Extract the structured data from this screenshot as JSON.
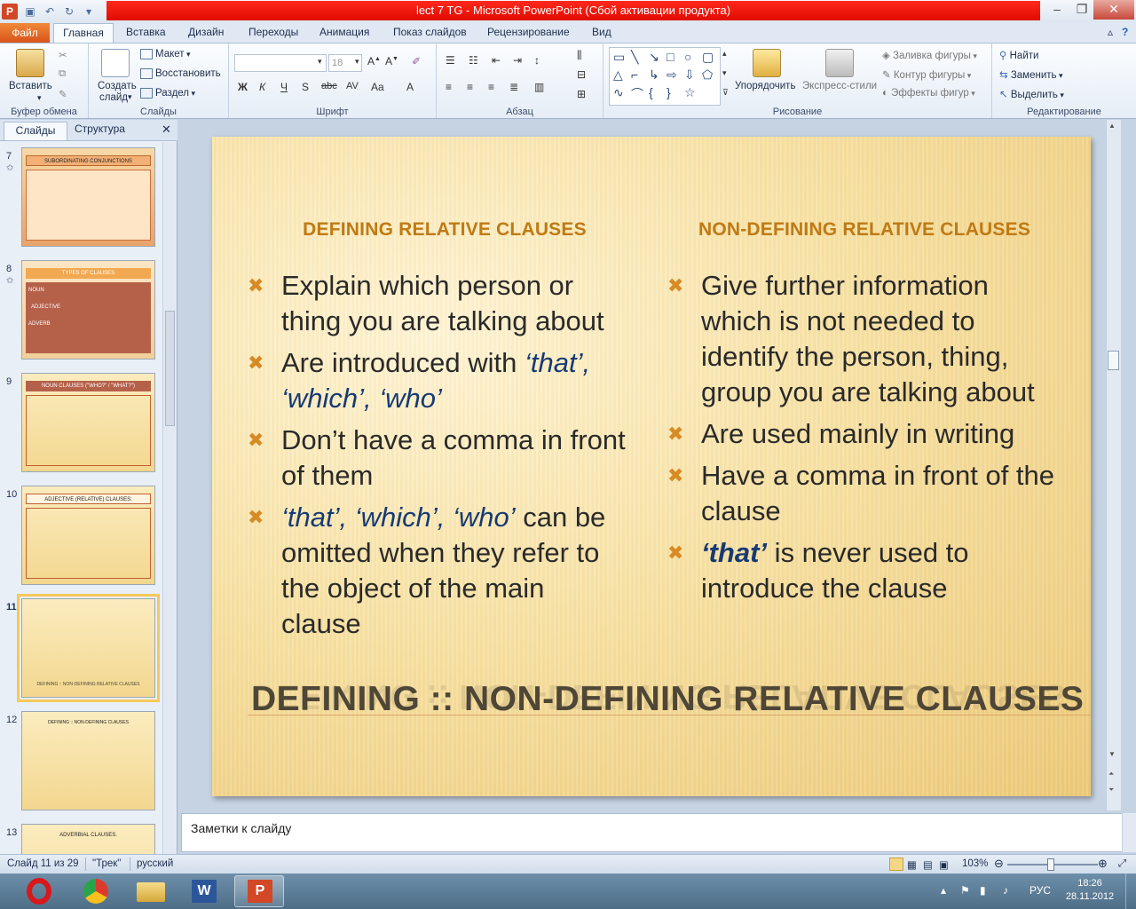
{
  "window": {
    "title": "lect 7 TG - Microsoft PowerPoint (Сбой активации продукта)"
  },
  "ribbon": {
    "tabs": [
      "Главная",
      "Вставка",
      "Дизайн",
      "Переходы",
      "Анимация",
      "Показ слайдов",
      "Рецензирование",
      "Вид"
    ],
    "file_tab": "Файл",
    "groups": {
      "clipboard": {
        "label": "Буфер обмена",
        "paste": "Вставить"
      },
      "slides": {
        "label": "Слайды",
        "new_slide_line1": "Создать",
        "new_slide_line2": "слайд",
        "layout": "Макет",
        "reset": "Восстановить",
        "section": "Раздел"
      },
      "font": {
        "label": "Шрифт",
        "size": "18"
      },
      "paragraph": {
        "label": "Абзац"
      },
      "drawing": {
        "label": "Рисование",
        "arrange": "Упорядочить",
        "quick_styles": "Экспресс-стили",
        "fill": "Заливка фигуры",
        "outline": "Контур фигуры",
        "effects": "Эффекты фигур"
      },
      "editing": {
        "label": "Редактирование",
        "find": "Найти",
        "replace": "Заменить",
        "select": "Выделить"
      }
    }
  },
  "left_pane": {
    "tabs": [
      "Слайды",
      "Структура"
    ],
    "thumbnails": [
      {
        "num": "7",
        "title": "SUBORDINATING CONJUNCTIONS"
      },
      {
        "num": "8",
        "title": "TYPES OF CLAUSES",
        "items": [
          "NOUN",
          "ADJECTIVE",
          "ADVERB"
        ]
      },
      {
        "num": "9",
        "title": "NOUN CLAUSES (\"WHO?\" / \"WHAT?\")"
      },
      {
        "num": "10",
        "title": "ADJECTIVE (RELATIVE) CLAUSES:"
      },
      {
        "num": "11",
        "title": "DEFINING :: NON-DEFINING RELATIVE CLAUSES"
      },
      {
        "num": "12",
        "title": "DEFINING :: NON-DEFINING CLAUSES"
      },
      {
        "num": "13",
        "title": "ADVERBIAL CLAUSES."
      }
    ]
  },
  "slide": {
    "left": {
      "title": "DEFINING RELATIVE CLAUSES",
      "b1": "Explain which person or thing you are talking about",
      "b2_pre": "Are introduced with ",
      "b2_words": "‘that’, ‘which’, ‘who’",
      "b3": "Don’t have a comma in front of them",
      "b4_words": "‘that’, ‘which’, ‘who’",
      "b4_post": " can be omitted when they refer to the object of the main clause"
    },
    "right": {
      "title": "NON-DEFINING RELATIVE CLAUSES",
      "b1": "Give further information which is not needed to identify the person, thing, group you are talking about",
      "b2": "Are used mainly in writing",
      "b3": "Have a comma in front of the clause",
      "b4_word": "‘that’",
      "b4_post": " is never used to introduce the clause"
    },
    "main_title": "DEFINING :: NON-DEFINING RELATIVE CLAUSES"
  },
  "notes": {
    "placeholder": "Заметки к слайду"
  },
  "status": {
    "slide": "Слайд 11 из 29",
    "theme": "\"Трек\"",
    "language": "русский",
    "zoom": "103%"
  },
  "taskbar": {
    "lang": "РУС",
    "time": "18:26",
    "date": "28.11.2012"
  }
}
